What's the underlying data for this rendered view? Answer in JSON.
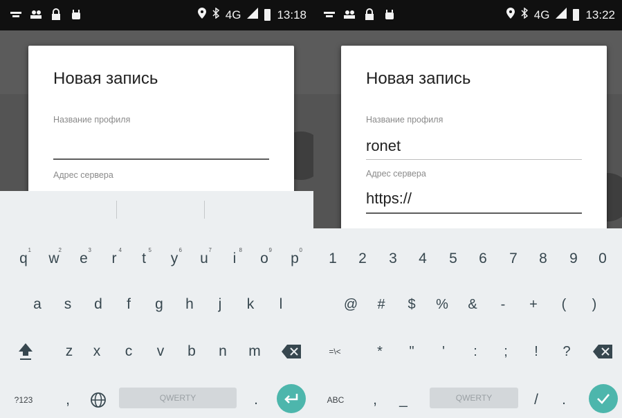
{
  "left": {
    "status": {
      "time": "13:18",
      "network": "4G"
    },
    "dialog": {
      "title": "Новая запись",
      "profile_label": "Название профиля",
      "profile_value": "",
      "server_label": "Адрес сервера"
    },
    "keyboard": {
      "row1": [
        {
          "k": "q",
          "h": "1"
        },
        {
          "k": "w",
          "h": "2"
        },
        {
          "k": "e",
          "h": "3"
        },
        {
          "k": "r",
          "h": "4"
        },
        {
          "k": "t",
          "h": "5"
        },
        {
          "k": "y",
          "h": "6"
        },
        {
          "k": "u",
          "h": "7"
        },
        {
          "k": "i",
          "h": "8"
        },
        {
          "k": "o",
          "h": "9"
        },
        {
          "k": "p",
          "h": "0"
        }
      ],
      "row2": [
        "a",
        "s",
        "d",
        "f",
        "g",
        "h",
        "j",
        "k",
        "l"
      ],
      "row3": [
        "z",
        "x",
        "c",
        "v",
        "b",
        "n",
        "m"
      ],
      "mode_key": "?123",
      "comma": ",",
      "space_label": "QWERTY",
      "period": "."
    }
  },
  "right": {
    "status": {
      "time": "13:22",
      "network": "4G"
    },
    "dialog": {
      "title": "Новая запись",
      "profile_label": "Название профиля",
      "profile_value": "ronet",
      "server_label": "Адрес сервера",
      "server_value": "https://"
    },
    "keyboard": {
      "row1": [
        "1",
        "2",
        "3",
        "4",
        "5",
        "6",
        "7",
        "8",
        "9",
        "0"
      ],
      "row2": [
        "@",
        "#",
        "$",
        "%",
        "&",
        "-",
        "+",
        "(",
        ")"
      ],
      "row3": [
        "*",
        "\"",
        "'",
        ":",
        ";",
        "!",
        "?"
      ],
      "mode_key": "=\\<",
      "abc_key": "ABC",
      "comma": ",",
      "underscore": "_",
      "space_label": "QWERTY",
      "slash": "/",
      "period": "."
    }
  },
  "colors": {
    "accent": "#4db6ac",
    "key_text": "#37474f",
    "keyboard_bg": "#eceff1",
    "status_bar": "#101010"
  }
}
